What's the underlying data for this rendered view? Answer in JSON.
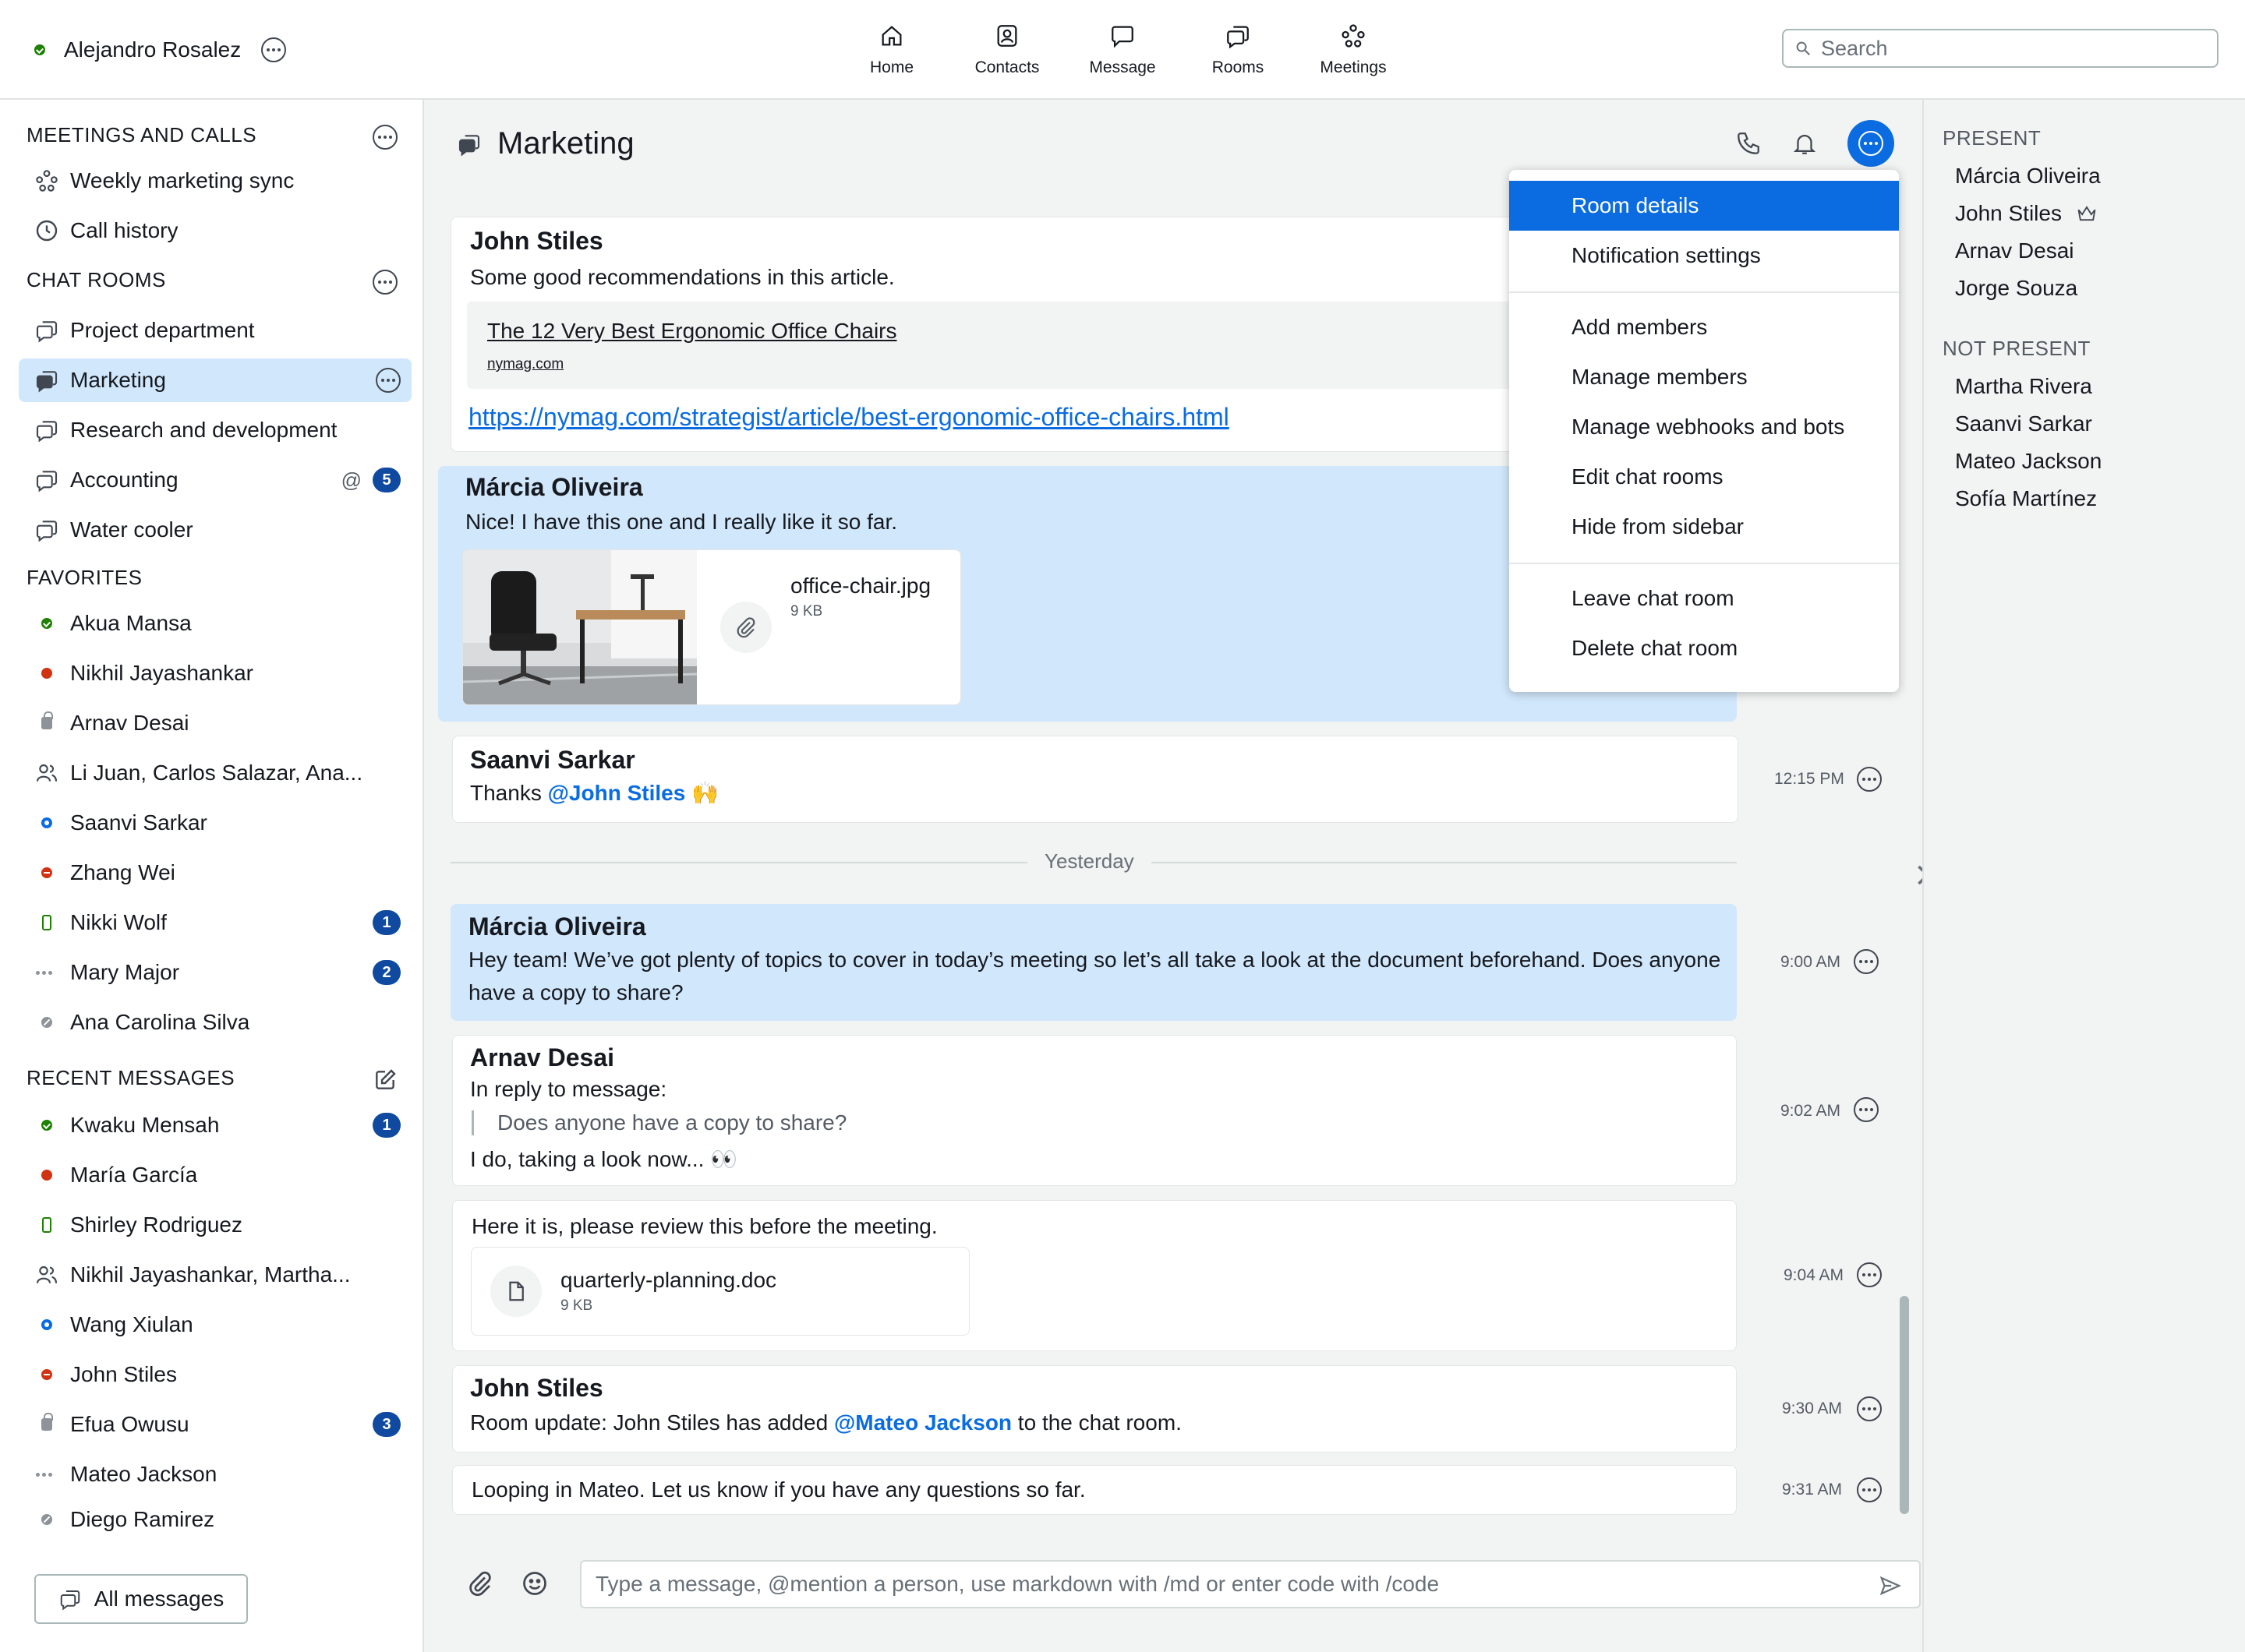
{
  "user": {
    "name": "Alejandro Rosalez"
  },
  "nav": [
    {
      "label": "Home",
      "icon": "home-icon"
    },
    {
      "label": "Contacts",
      "icon": "contacts-icon"
    },
    {
      "label": "Message",
      "icon": "message-icon"
    },
    {
      "label": "Rooms",
      "icon": "rooms-icon"
    },
    {
      "label": "Meetings",
      "icon": "meetings-icon"
    }
  ],
  "search": {
    "placeholder": "Search"
  },
  "sidebar": {
    "meetings_header": "MEETINGS AND CALLS",
    "meetings": [
      {
        "label": "Weekly marketing sync",
        "icon": "meetings-icon"
      },
      {
        "label": "Call history",
        "icon": "clock-icon"
      }
    ],
    "rooms_header": "CHAT ROOMS",
    "rooms": [
      {
        "label": "Project department"
      },
      {
        "label": "Marketing",
        "active": true
      },
      {
        "label": "Research and development"
      },
      {
        "label": "Accounting",
        "mention": "@",
        "badge": "5"
      },
      {
        "label": "Water cooler"
      }
    ],
    "favorites_header": "FAVORITES",
    "favorites": [
      {
        "label": "Akua Mansa",
        "status": "available"
      },
      {
        "label": "Nikhil Jayashankar",
        "status": "busy"
      },
      {
        "label": "Arnav Desai",
        "status": "private"
      },
      {
        "label": "Li Juan, Carlos Salazar, Ana...",
        "status": "group"
      },
      {
        "label": "Saanvi Sarkar",
        "status": "away"
      },
      {
        "label": "Zhang Wei",
        "status": "dnd"
      },
      {
        "label": "Nikki Wolf",
        "status": "mobile",
        "badge": "1"
      },
      {
        "label": "Mary Major",
        "status": "idle",
        "badge": "2"
      },
      {
        "label": "Ana Carolina Silva",
        "status": "offline"
      }
    ],
    "recent_header": "RECENT MESSAGES",
    "recent": [
      {
        "label": "Kwaku Mensah",
        "status": "available",
        "badge": "1"
      },
      {
        "label": "María García",
        "status": "busy"
      },
      {
        "label": "Shirley Rodriguez",
        "status": "mobile"
      },
      {
        "label": "Nikhil Jayashankar, Martha...",
        "status": "group"
      },
      {
        "label": "Wang Xiulan",
        "status": "away"
      },
      {
        "label": "John Stiles",
        "status": "dnd"
      },
      {
        "label": "Efua Owusu",
        "status": "private",
        "badge": "3"
      },
      {
        "label": "Mateo Jackson",
        "status": "idle"
      },
      {
        "label": "Diego Ramirez",
        "status": "offline"
      }
    ],
    "all_messages": "All messages"
  },
  "room": {
    "title": "Marketing",
    "messages": [
      {
        "author": "John Stiles",
        "text": "Some good recommendations in this article.",
        "link_title": "The 12 Very Best Ergonomic Office Chairs",
        "link_domain": "nymag.com",
        "url": "https://nymag.com/strategist/article/best-ergonomic-office-chairs.html"
      },
      {
        "author": "Márcia Oliveira",
        "text": "Nice! I have this one and I really like it so far.",
        "file_name": "office-chair.jpg",
        "file_size": "9 KB"
      },
      {
        "author": "Saanvi Sarkar",
        "text_before": "Thanks ",
        "mention": "@John Stiles",
        "emoji": "🙌",
        "time": "12:15 PM"
      },
      {
        "divider": "Yesterday"
      },
      {
        "author": "Márcia Oliveira",
        "text": "Hey team! We’ve got plenty of topics to cover in today’s meeting so let’s all take a look at the document beforehand. Does anyone have a copy to share?",
        "time": "9:00 AM"
      },
      {
        "author": "Arnav Desai",
        "reply_label": "In reply to message:",
        "quote": "Does anyone have a copy to share?",
        "text": "I do, taking a look now... 👀",
        "time": "9:02 AM"
      },
      {
        "text": "Here it is, please review this before the meeting.",
        "file_name": "quarterly-planning.doc",
        "file_size": "9 KB",
        "time": "9:04 AM"
      },
      {
        "author": "John Stiles",
        "text_before": "Room update: John Stiles has added ",
        "mention": "@Mateo Jackson",
        "text_after": " to the chat room.",
        "time": "9:30 AM"
      },
      {
        "text": "Looping in Mateo. Let us know if you have any questions so far.",
        "time": "9:31 AM"
      }
    ]
  },
  "composer": {
    "placeholder": "Type a message, @mention a person, use markdown with /md or enter code with /code"
  },
  "menu": {
    "group1": [
      "Room details",
      "Notification settings"
    ],
    "group2": [
      "Add members",
      "Manage members",
      "Manage webhooks and bots",
      "Edit chat rooms",
      "Hide from sidebar"
    ],
    "group3": [
      "Leave chat room",
      "Delete chat room"
    ],
    "selected": "Room details"
  },
  "members": {
    "present_header": "PRESENT",
    "present": [
      "Márcia Oliveira",
      "John Stiles",
      "Arnav Desai",
      "Jorge Souza"
    ],
    "not_present_header": "NOT PRESENT",
    "not_present": [
      "Martha Rivera",
      "Saanvi Sarkar",
      "Mateo Jackson",
      "Sofía Martínez"
    ]
  },
  "colors": {
    "accent": "#0a6ce0",
    "highlight": "#d1e7fb",
    "badge": "#0f4aa0",
    "available": "#1d8102",
    "busy": "#d13212"
  }
}
